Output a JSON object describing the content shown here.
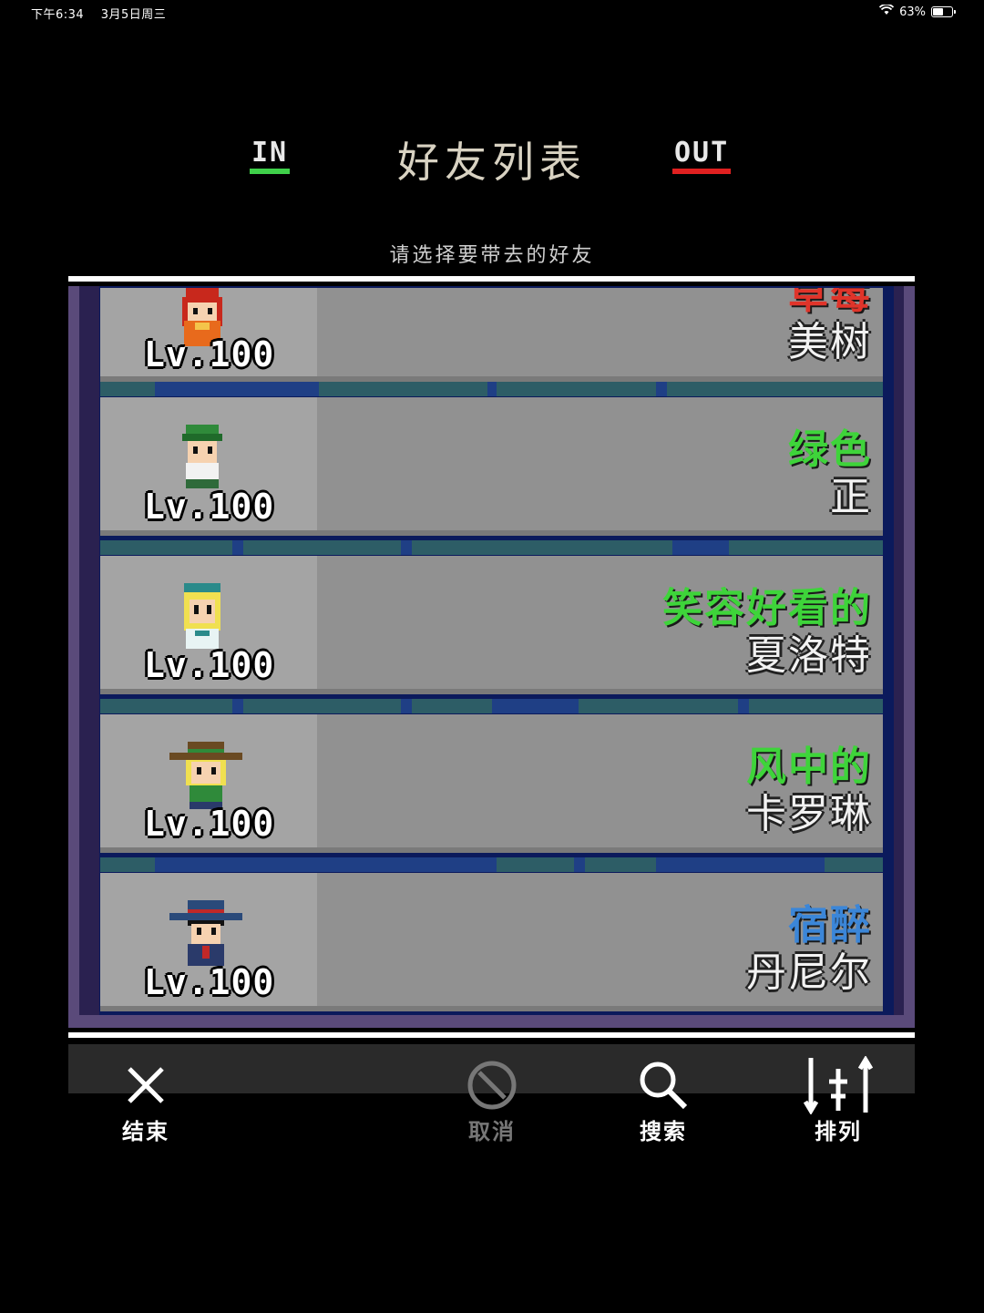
{
  "status_bar": {
    "time": "下午6:34",
    "date": "3月5日周三",
    "battery": "63%",
    "battery_level": 0.63,
    "icons": [
      "wifi-icon",
      "battery-icon"
    ]
  },
  "header": {
    "tab_in": "IN",
    "tab_out": "OUT",
    "title": "好友列表",
    "subtitle": "请选择要带去的好友"
  },
  "friends": [
    {
      "level": "Lv.100",
      "title": "草莓",
      "name": "美树",
      "title_color": "#e0342a",
      "sprite": "red-hair-girl"
    },
    {
      "level": "Lv.100",
      "title": "绿色",
      "name": "正",
      "title_color": "#3ed43a",
      "sprite": "green-cap-boy"
    },
    {
      "level": "Lv.100",
      "title": "笑容好看的",
      "name": "夏洛特",
      "title_color": "#3ed43a",
      "sprite": "blonde-girl"
    },
    {
      "level": "Lv.100",
      "title": "风中的",
      "name": "卡罗琳",
      "title_color": "#3ed43a",
      "sprite": "cowboy-hat-girl"
    },
    {
      "level": "Lv.100",
      "title": "宿醉",
      "name": "丹尼尔",
      "title_color": "#3b86d8",
      "sprite": "fedora-man"
    }
  ],
  "toolbar": {
    "end_label": "结束",
    "cancel_label": "取消",
    "search_label": "搜索",
    "sort_label": "排列"
  },
  "colors": {
    "in_accent": "#3fd04a",
    "out_accent": "#e02020",
    "card_bg": "#919191",
    "list_border": "#5a4a7a"
  }
}
